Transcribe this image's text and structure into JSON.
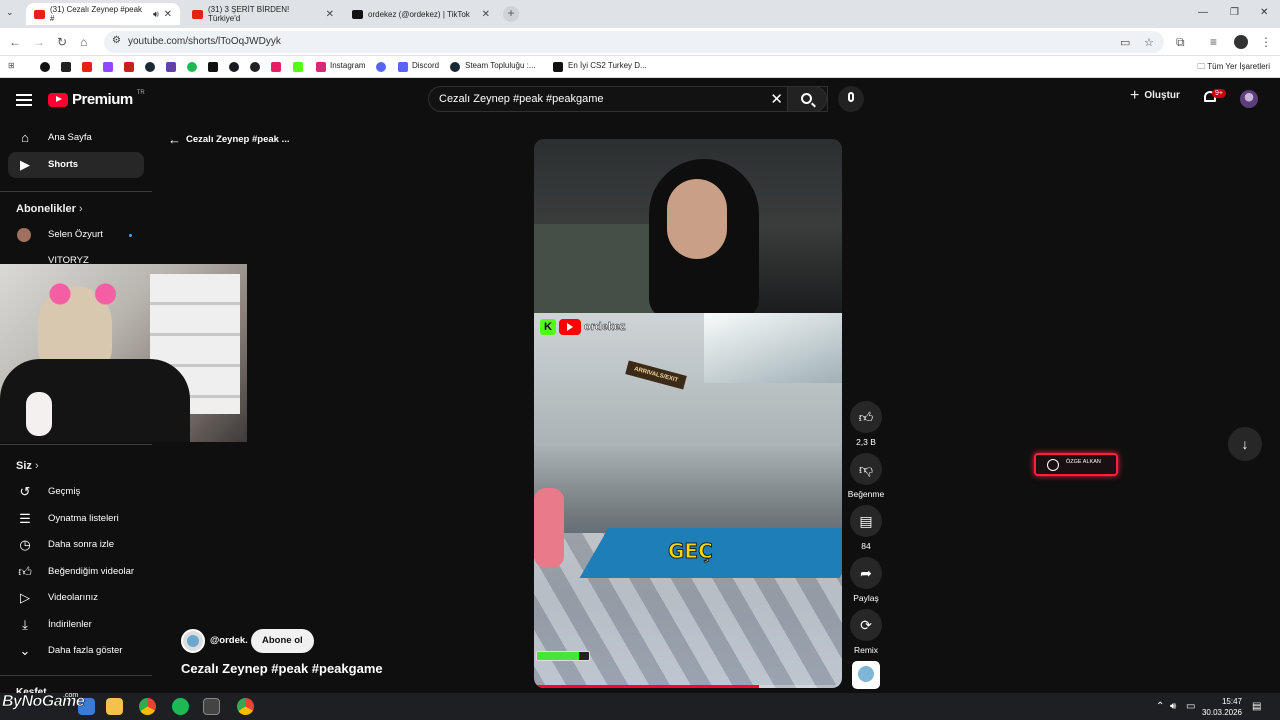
{
  "browser": {
    "tabs": [
      {
        "title": "(31) Cezalı Zeynep #peak #",
        "active": true
      },
      {
        "title": "(31) 3 ŞERİT BİRDEN! Türkiye'd",
        "active": false
      },
      {
        "title": "ordekez (@ordekez) | TikTok",
        "active": false
      }
    ],
    "url": "youtube.com/shorts/lToOqJWDyyk",
    "bookmarks": [
      "Instagram",
      "Discord",
      "Steam Topluluğu :...",
      "En İyi CS2 Turkey D..."
    ],
    "all_bookmarks": "Tüm Yer İşaretleri"
  },
  "header": {
    "logo_text": "Premium",
    "logo_region": "TR",
    "search_query": "Cezalı Zeynep #peak #peakgame",
    "create_label": "Oluştur",
    "notif_badge": "9+"
  },
  "sidebar": {
    "top_items": [
      {
        "label": "Ana Sayfa",
        "icon": "home-icon"
      },
      {
        "label": "Shorts",
        "icon": "shorts-icon",
        "selected": true
      }
    ],
    "subs_heading": "Abonelikler",
    "subs": [
      {
        "label": "Selen Özyurt"
      },
      {
        "label": "VITORYZ"
      }
    ],
    "you_heading": "Siz",
    "you_items": [
      {
        "label": "Geçmiş",
        "icon": "history-icon"
      },
      {
        "label": "Oynatma listeleri",
        "icon": "playlist-icon"
      },
      {
        "label": "Daha sonra izle",
        "icon": "clock-icon"
      },
      {
        "label": "Beğendiğim videolar",
        "icon": "thumb-up-icon"
      },
      {
        "label": "Videolarınız",
        "icon": "video-icon"
      },
      {
        "label": "İndirilenler",
        "icon": "download-icon"
      },
      {
        "label": "Daha fazla göster",
        "icon": "chevron-down-icon"
      }
    ],
    "cut_heading": "Keşfet"
  },
  "short": {
    "back_title": "Cezalı Zeynep #peak ...",
    "channel": "@ordek.",
    "subscribe": "Abone ol",
    "title": "Cezalı Zeynep #peak #peakgame",
    "overlay_channel": "ordekez",
    "overlay_sign": "ARRIVALS/EXIT",
    "overlay_word": "GEÇ",
    "progress": 0.73,
    "actions": {
      "likes": "2,3 B",
      "dislike": "Beğenme",
      "comments": "84",
      "share": "Paylaş",
      "remix": "Remix"
    }
  },
  "stream_alert": "ÖZGE ALKAN",
  "watermark": {
    "text": "ByNoGame",
    "suffix": ".com"
  },
  "taskbar": {
    "time": "15:47",
    "date": "30.03.2026"
  },
  "colors": {
    "accent": "#ff0033",
    "background": "#0f0f0f"
  }
}
